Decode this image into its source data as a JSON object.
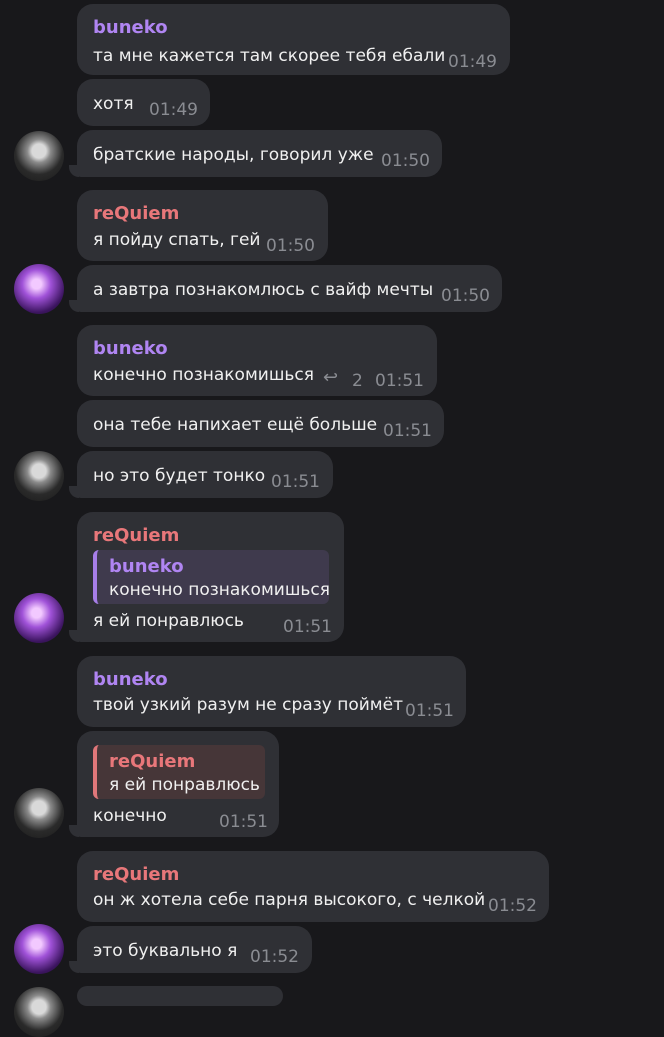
{
  "users": {
    "bun": "buneko",
    "req": "reQuiem"
  },
  "messages": [
    {
      "text": "та мне кажется там скорее тебя ебали",
      "time": "01:49"
    },
    {
      "text": "хотя",
      "time": "01:49"
    },
    {
      "text": "братские народы, говорил уже",
      "time": "01:50"
    },
    {
      "text": "я пойду спать, гей",
      "time": "01:50"
    },
    {
      "text": "а завтра познакомлюсь с вайф мечты",
      "time": "01:50"
    },
    {
      "text": "конечно познакомишься",
      "time": "01:51",
      "replies": "2"
    },
    {
      "text": "она тебе напихает ещё больше",
      "time": "01:51"
    },
    {
      "text": "но это будет тонко",
      "time": "01:51"
    },
    {
      "text": "я ей понравлюсь",
      "time": "01:51",
      "quote_text": "конечно познакомишься"
    },
    {
      "text": "твой узкий разум не сразу поймёт",
      "time": "01:51"
    },
    {
      "text": "конечно",
      "time": "01:51",
      "quote_text": "я ей понравлюсь"
    },
    {
      "text": "он ж хотела себе парня высокого, с челкой",
      "time": "01:52"
    },
    {
      "text": "это буквально я",
      "time": "01:52"
    }
  ]
}
